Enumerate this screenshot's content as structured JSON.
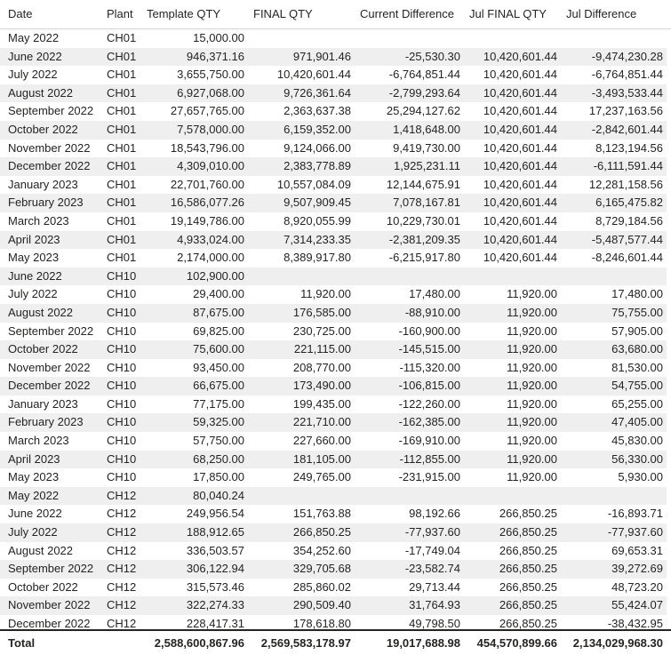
{
  "headers": {
    "date": "Date",
    "plant": "Plant",
    "template_qty": "Template QTY",
    "final_qty": "FINAL QTY",
    "current_difference": "Current Difference",
    "jul_final_qty": "Jul FINAL QTY",
    "jul_difference": "Jul Difference"
  },
  "rows": [
    {
      "date": "May 2022",
      "plant": "CH01",
      "tq": "15,000.00",
      "fq": "",
      "cd": "",
      "jfq": "",
      "jd": ""
    },
    {
      "date": "June 2022",
      "plant": "CH01",
      "tq": "946,371.16",
      "fq": "971,901.46",
      "cd": "-25,530.30",
      "jfq": "10,420,601.44",
      "jd": "-9,474,230.28"
    },
    {
      "date": "July 2022",
      "plant": "CH01",
      "tq": "3,655,750.00",
      "fq": "10,420,601.44",
      "cd": "-6,764,851.44",
      "jfq": "10,420,601.44",
      "jd": "-6,764,851.44"
    },
    {
      "date": "August 2022",
      "plant": "CH01",
      "tq": "6,927,068.00",
      "fq": "9,726,361.64",
      "cd": "-2,799,293.64",
      "jfq": "10,420,601.44",
      "jd": "-3,493,533.44"
    },
    {
      "date": "September 2022",
      "plant": "CH01",
      "tq": "27,657,765.00",
      "fq": "2,363,637.38",
      "cd": "25,294,127.62",
      "jfq": "10,420,601.44",
      "jd": "17,237,163.56"
    },
    {
      "date": "October 2022",
      "plant": "CH01",
      "tq": "7,578,000.00",
      "fq": "6,159,352.00",
      "cd": "1,418,648.00",
      "jfq": "10,420,601.44",
      "jd": "-2,842,601.44"
    },
    {
      "date": "November 2022",
      "plant": "CH01",
      "tq": "18,543,796.00",
      "fq": "9,124,066.00",
      "cd": "9,419,730.00",
      "jfq": "10,420,601.44",
      "jd": "8,123,194.56"
    },
    {
      "date": "December 2022",
      "plant": "CH01",
      "tq": "4,309,010.00",
      "fq": "2,383,778.89",
      "cd": "1,925,231.11",
      "jfq": "10,420,601.44",
      "jd": "-6,111,591.44"
    },
    {
      "date": "January 2023",
      "plant": "CH01",
      "tq": "22,701,760.00",
      "fq": "10,557,084.09",
      "cd": "12,144,675.91",
      "jfq": "10,420,601.44",
      "jd": "12,281,158.56"
    },
    {
      "date": "February 2023",
      "plant": "CH01",
      "tq": "16,586,077.26",
      "fq": "9,507,909.45",
      "cd": "7,078,167.81",
      "jfq": "10,420,601.44",
      "jd": "6,165,475.82"
    },
    {
      "date": "March 2023",
      "plant": "CH01",
      "tq": "19,149,786.00",
      "fq": "8,920,055.99",
      "cd": "10,229,730.01",
      "jfq": "10,420,601.44",
      "jd": "8,729,184.56"
    },
    {
      "date": "April 2023",
      "plant": "CH01",
      "tq": "4,933,024.00",
      "fq": "7,314,233.35",
      "cd": "-2,381,209.35",
      "jfq": "10,420,601.44",
      "jd": "-5,487,577.44"
    },
    {
      "date": "May 2023",
      "plant": "CH01",
      "tq": "2,174,000.00",
      "fq": "8,389,917.80",
      "cd": "-6,215,917.80",
      "jfq": "10,420,601.44",
      "jd": "-8,246,601.44"
    },
    {
      "date": "June 2022",
      "plant": "CH10",
      "tq": "102,900.00",
      "fq": "",
      "cd": "",
      "jfq": "",
      "jd": ""
    },
    {
      "date": "July 2022",
      "plant": "CH10",
      "tq": "29,400.00",
      "fq": "11,920.00",
      "cd": "17,480.00",
      "jfq": "11,920.00",
      "jd": "17,480.00"
    },
    {
      "date": "August 2022",
      "plant": "CH10",
      "tq": "87,675.00",
      "fq": "176,585.00",
      "cd": "-88,910.00",
      "jfq": "11,920.00",
      "jd": "75,755.00"
    },
    {
      "date": "September 2022",
      "plant": "CH10",
      "tq": "69,825.00",
      "fq": "230,725.00",
      "cd": "-160,900.00",
      "jfq": "11,920.00",
      "jd": "57,905.00"
    },
    {
      "date": "October 2022",
      "plant": "CH10",
      "tq": "75,600.00",
      "fq": "221,115.00",
      "cd": "-145,515.00",
      "jfq": "11,920.00",
      "jd": "63,680.00"
    },
    {
      "date": "November 2022",
      "plant": "CH10",
      "tq": "93,450.00",
      "fq": "208,770.00",
      "cd": "-115,320.00",
      "jfq": "11,920.00",
      "jd": "81,530.00"
    },
    {
      "date": "December 2022",
      "plant": "CH10",
      "tq": "66,675.00",
      "fq": "173,490.00",
      "cd": "-106,815.00",
      "jfq": "11,920.00",
      "jd": "54,755.00"
    },
    {
      "date": "January 2023",
      "plant": "CH10",
      "tq": "77,175.00",
      "fq": "199,435.00",
      "cd": "-122,260.00",
      "jfq": "11,920.00",
      "jd": "65,255.00"
    },
    {
      "date": "February 2023",
      "plant": "CH10",
      "tq": "59,325.00",
      "fq": "221,710.00",
      "cd": "-162,385.00",
      "jfq": "11,920.00",
      "jd": "47,405.00"
    },
    {
      "date": "March 2023",
      "plant": "CH10",
      "tq": "57,750.00",
      "fq": "227,660.00",
      "cd": "-169,910.00",
      "jfq": "11,920.00",
      "jd": "45,830.00"
    },
    {
      "date": "April 2023",
      "plant": "CH10",
      "tq": "68,250.00",
      "fq": "181,105.00",
      "cd": "-112,855.00",
      "jfq": "11,920.00",
      "jd": "56,330.00"
    },
    {
      "date": "May 2023",
      "plant": "CH10",
      "tq": "17,850.00",
      "fq": "249,765.00",
      "cd": "-231,915.00",
      "jfq": "11,920.00",
      "jd": "5,930.00"
    },
    {
      "date": "May 2022",
      "plant": "CH12",
      "tq": "80,040.24",
      "fq": "",
      "cd": "",
      "jfq": "",
      "jd": ""
    },
    {
      "date": "June 2022",
      "plant": "CH12",
      "tq": "249,956.54",
      "fq": "151,763.88",
      "cd": "98,192.66",
      "jfq": "266,850.25",
      "jd": "-16,893.71"
    },
    {
      "date": "July 2022",
      "plant": "CH12",
      "tq": "188,912.65",
      "fq": "266,850.25",
      "cd": "-77,937.60",
      "jfq": "266,850.25",
      "jd": "-77,937.60"
    },
    {
      "date": "August 2022",
      "plant": "CH12",
      "tq": "336,503.57",
      "fq": "354,252.60",
      "cd": "-17,749.04",
      "jfq": "266,850.25",
      "jd": "69,653.31"
    },
    {
      "date": "September 2022",
      "plant": "CH12",
      "tq": "306,122.94",
      "fq": "329,705.68",
      "cd": "-23,582.74",
      "jfq": "266,850.25",
      "jd": "39,272.69"
    },
    {
      "date": "October 2022",
      "plant": "CH12",
      "tq": "315,573.46",
      "fq": "285,860.02",
      "cd": "29,713.44",
      "jfq": "266,850.25",
      "jd": "48,723.20"
    },
    {
      "date": "November 2022",
      "plant": "CH12",
      "tq": "322,274.33",
      "fq": "290,509.40",
      "cd": "31,764.93",
      "jfq": "266,850.25",
      "jd": "55,424.07"
    },
    {
      "date": "December 2022",
      "plant": "CH12",
      "tq": "228,417.31",
      "fq": "178,618.80",
      "cd": "49,798.50",
      "jfq": "266,850.25",
      "jd": "-38,432.95"
    }
  ],
  "total": {
    "label": "Total",
    "tq": "2,588,600,867.96",
    "fq": "2,569,583,178.97",
    "cd": "19,017,688.98",
    "jfq": "454,570,899.66",
    "jd": "2,134,029,968.30"
  }
}
